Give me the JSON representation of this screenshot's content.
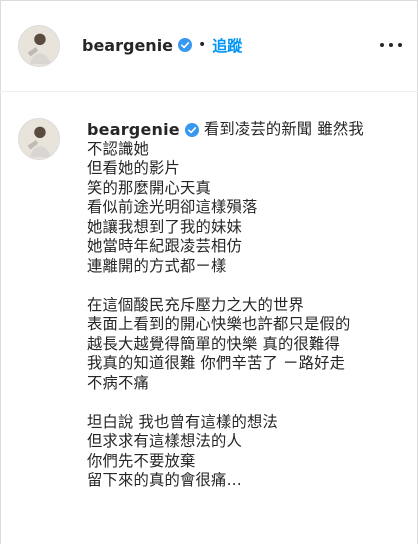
{
  "header": {
    "username": "beargenie",
    "separator": "•",
    "follow_label": "追蹤"
  },
  "caption": {
    "username": "beargenie",
    "first_text": "看到凌芸的新聞 雖然我",
    "lines": [
      "不認識她",
      "但看她的影片",
      "笑的那麼開心天真",
      "看似前途光明卻這樣殞落",
      "她讓我想到了我的妹妹",
      "她當時年紀跟凌芸相仿",
      "連離開的方式都ㄧ樣",
      "",
      "在這個酸民充斥壓力之大的世界",
      "表面上看到的開心快樂也許都只是假的",
      "越長大越覺得簡單的快樂 真的很難得",
      "我真的知道很難 你們辛苦了 ㄧ路好走",
      "不病不痛",
      "",
      "坦白說 我也曾有這樣的想法",
      "但求求有這樣想法的人",
      "你們先不要放棄",
      "留下來的真的會很痛…"
    ]
  },
  "colors": {
    "accent": "#0095f6",
    "verified": "#3897f0",
    "text": "#262626",
    "border": "#dbdbdb"
  }
}
